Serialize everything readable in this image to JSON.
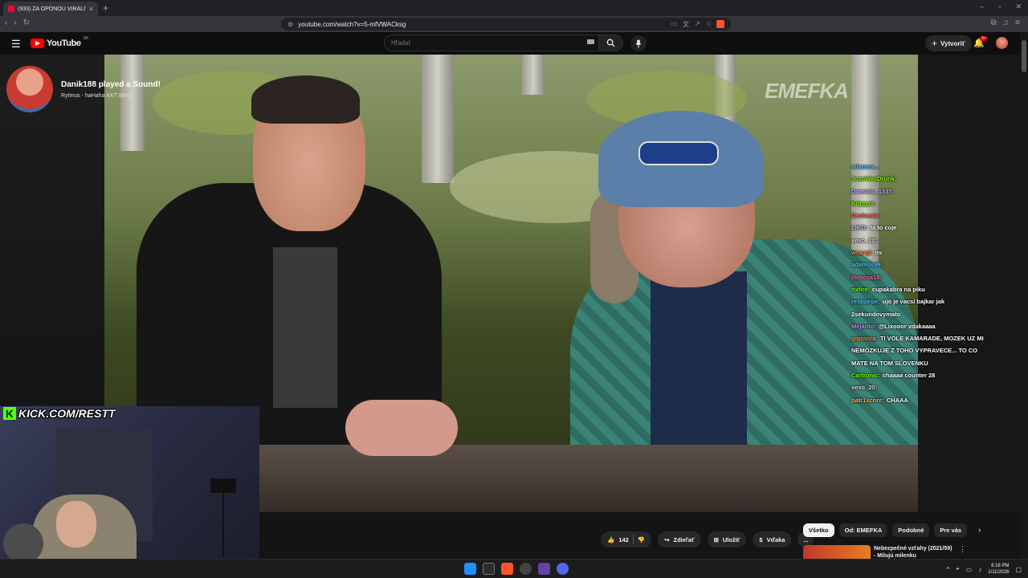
{
  "browser": {
    "tab_title": "(933) ZA OPONOU VIRALITY",
    "new_tab": "+",
    "url": "youtube.com/watch?v=5-mfVWACksg"
  },
  "youtube": {
    "logo_text": "YouTube",
    "country_code": "SK",
    "search_placeholder": "Hľadať",
    "create_label": "Vytvoriť",
    "notification_count": "9+"
  },
  "alert": {
    "title": "Danik188 played a Sound!",
    "subtitle": "Rytmus - haHaha KKT Blerp"
  },
  "watermark": "EMEFKA",
  "chat": [
    {
      "user": "adamos...",
      "msg": "",
      "color": "#59c1ff"
    },
    {
      "user": "JozoWasDrunk:",
      "msg": "",
      "color": "#7CFC00"
    },
    {
      "user": "Dominic_1337:",
      "msg": "",
      "color": "#b8b8ff"
    },
    {
      "user": "fizippy1:",
      "msg": "",
      "color": "#7CFC00"
    },
    {
      "user": "Dechanix:",
      "msg": "",
      "color": "#ff6b6b"
    },
    {
      "user": "LIKO:",
      "msg": "ta to coje",
      "color": "#b8b8ff"
    },
    {
      "user": "vexo_20:",
      "msg": "",
      "color": "#dddddd"
    },
    {
      "user": "wrangi:",
      "msg": "ns",
      "color": "#ff8c42"
    },
    {
      "user": "adamos99:",
      "msg": "",
      "color": "#59c1ff"
    },
    {
      "user": "jhroosa18:",
      "msg": "",
      "color": "#ff6b9e"
    },
    {
      "user": "nxfire:",
      "msg": "cupakabra na piku",
      "color": "#7CFC00"
    },
    {
      "user": "restipepe:",
      "msg": "ujo je vacsi bajkar jak 2sekundovymato",
      "color": "#59c1ff"
    },
    {
      "user": "Mejanto:",
      "msg": "@Lixooor vdakaaaa",
      "color": "#c58cff"
    },
    {
      "user": "gigovica:",
      "msg": "TI VOLE KAMARADE, MOZEK UZ MI NEMOZKUJE Z TOHO VYPRAVECE... TO CO MATE NA TOM SLOVENKU",
      "color": "#ff8c42"
    },
    {
      "user": "Cartronic:",
      "msg": "chaaaa counter 28",
      "color": "#7CFC00"
    },
    {
      "user": "vexo_20:",
      "msg": "",
      "color": "#dddddd"
    },
    {
      "user": "patr1xcore:",
      "msg": "CHAAA",
      "color": "#ffb347"
    }
  ],
  "kick_label": "KICK.COM/RESTT",
  "actions": {
    "likes": "142",
    "share": "Zdieľať",
    "save": "Uložiť",
    "thanks": "Vďaka",
    "more": "..."
  },
  "chips": [
    "Všetko",
    "Od: EMEFKA",
    "Podobné",
    "Pre vás"
  ],
  "reco": {
    "title": "Nebezpečné vzťahy (2021/59) - Milujú milenku"
  },
  "clock": {
    "time": "8:18 PM",
    "date": "1/11/2026"
  },
  "colors": {
    "kick_green": "#53fc18",
    "yt_red": "#ff0000"
  }
}
